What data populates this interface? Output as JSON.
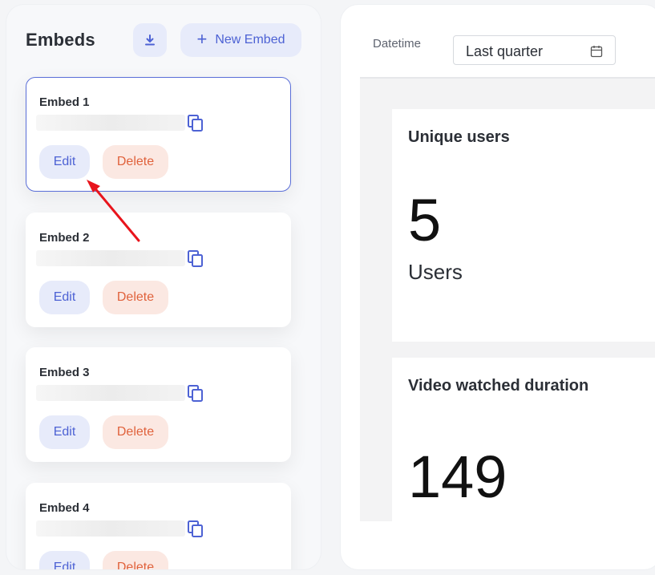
{
  "embeds_panel": {
    "title": "Embeds",
    "download_icon": "download-icon",
    "new_embed_label": "New Embed",
    "cards": [
      {
        "name": "Embed 1",
        "edit": "Edit",
        "delete": "Delete",
        "selected": true
      },
      {
        "name": "Embed 2",
        "edit": "Edit",
        "delete": "Delete",
        "selected": false
      },
      {
        "name": "Embed 3",
        "edit": "Edit",
        "delete": "Delete",
        "selected": false
      },
      {
        "name": "Embed 4",
        "edit": "Edit",
        "delete": "Delete",
        "selected": false
      }
    ]
  },
  "dashboard": {
    "filter_label": "Datetime",
    "filter_value": "Last quarter",
    "calendar_icon": "calendar-icon",
    "metrics": [
      {
        "title": "Unique users",
        "value": "5",
        "unit": "Users"
      },
      {
        "title": "Video watched duration",
        "value": "149"
      }
    ]
  },
  "colors": {
    "accent": "#4d62d4",
    "accent_bg": "#e7ebfa",
    "danger": "#e0623c",
    "danger_bg": "#fbe8e2",
    "annotation_arrow": "#e8141c"
  }
}
